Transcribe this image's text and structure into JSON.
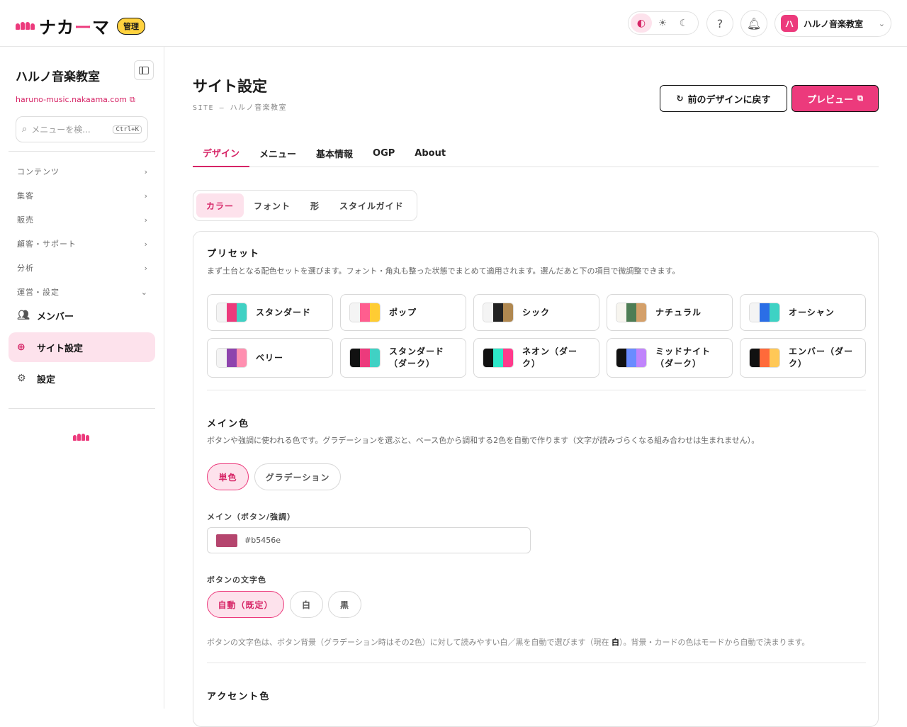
{
  "header": {
    "logo_text_a": "ナカ",
    "logo_text_dash": "ー",
    "logo_text_b": "マ",
    "admin_badge": "管理",
    "user_avatar": "ハ",
    "user_name": "ハルノ音楽教室"
  },
  "sidebar": {
    "title": "ハルノ音楽教室",
    "url": "haruno-music.nakaama.com",
    "search_placeholder": "メニューを検...",
    "search_shortcut": "Ctrl+K",
    "groups": [
      {
        "label": "コンテンツ"
      },
      {
        "label": "集客"
      },
      {
        "label": "販売"
      },
      {
        "label": "顧客・サポート"
      },
      {
        "label": "分析"
      },
      {
        "label": "運営・設定"
      }
    ],
    "items": [
      {
        "label": "メンバー"
      },
      {
        "label": "サイト設定"
      },
      {
        "label": "設定"
      }
    ]
  },
  "page": {
    "title": "サイト設定",
    "subtitle": "SITE — ハルノ音楽教室",
    "revert_label": "前のデザインに戻す",
    "preview_label": "プレビュー"
  },
  "tabs": [
    "デザイン",
    "メニュー",
    "基本情報",
    "OGP",
    "About"
  ],
  "subtabs": [
    "カラー",
    "フォント",
    "形",
    "スタイルガイド"
  ],
  "presets_section": {
    "title": "プリセット",
    "desc": "まず土台となる配色セットを選びます。フォント・角丸も整った状態でまとめて適用されます。選んだあと下の項目で微調整できます。",
    "items": [
      {
        "name": "スタンダード",
        "colors": [
          "#f4f4f4",
          "#ec3a7c",
          "#40d1c4"
        ]
      },
      {
        "name": "ポップ",
        "colors": [
          "#f4f4f4",
          "#ff5e8f",
          "#ffcc33"
        ]
      },
      {
        "name": "シック",
        "colors": [
          "#f4f4f4",
          "#222222",
          "#b08850"
        ]
      },
      {
        "name": "ナチュラル",
        "colors": [
          "#f7f5ef",
          "#4e7d55",
          "#d4a06a"
        ]
      },
      {
        "name": "オーシャン",
        "colors": [
          "#f4f4f4",
          "#2b6ee6",
          "#3ed2c4"
        ]
      },
      {
        "name": "ベリー",
        "colors": [
          "#f4f4f4",
          "#8e44ad",
          "#ff8fb0"
        ]
      },
      {
        "name": "スタンダード（ダーク）",
        "colors": [
          "#111111",
          "#ec3a7c",
          "#40d1c4"
        ]
      },
      {
        "name": "ネオン（ダーク）",
        "colors": [
          "#111111",
          "#2ee6c8",
          "#ff3a8c"
        ]
      },
      {
        "name": "ミッドナイト（ダーク）",
        "colors": [
          "#111111",
          "#6a8cff",
          "#c084fc"
        ]
      },
      {
        "name": "エンバー（ダーク）",
        "colors": [
          "#111111",
          "#ff6a3a",
          "#ffc857"
        ]
      }
    ]
  },
  "main_color": {
    "title": "メイン色",
    "desc": "ボタンや強調に使われる色です。グラデーションを選ぶと、ベース色から調和する2色を自動で作ります（文字が読みづらくなる組み合わせは生まれません）。",
    "mode_solid": "単色",
    "mode_gradient": "グラデーション",
    "field_label": "メイン（ボタン/強調）",
    "value": "#b5456e",
    "swatch_color": "#b5456e"
  },
  "button_text": {
    "label": "ボタンの文字色",
    "opt_auto": "自動（既定）",
    "opt_white": "白",
    "opt_black": "黒",
    "note_a": "ボタンの文字色は、ボタン背景（グラデーション時はその2色）に対して読みやすい白／黒を自動で選びます（現在 ",
    "note_current": "白",
    "note_b": "）。背景・カードの色はモードから自動で決まります。"
  },
  "accent": {
    "title": "アクセント色"
  },
  "colors": {
    "brand": "#ec3a7c",
    "brand_soft": "#fde2ec",
    "badge": "#ffd23f"
  }
}
